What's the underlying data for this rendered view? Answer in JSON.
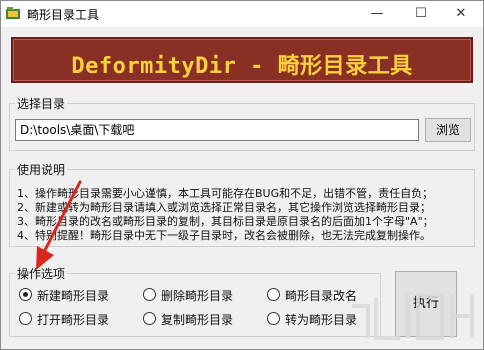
{
  "window": {
    "title": "畸形目录工具",
    "minimize_glyph": "—",
    "maximize_glyph": "☐",
    "close_glyph": "✕"
  },
  "banner": {
    "text": "DeformityDir - 畸形目录工具",
    "bg_color": "#8a2f24",
    "text_color": "#ffd13b"
  },
  "select_dir": {
    "label": "选择目录",
    "path_value": "D:\\tools\\桌面\\下载吧",
    "browse_label": "浏览"
  },
  "usage": {
    "label": "使用说明",
    "lines": [
      "1、操作畸形目录需要小心谨慎，本工具可能存在BUG和不足，出错不管，责任自负；",
      "2、新建或转为畸形目录请填入或浏览选择正常目录名，其它操作浏览选择畸形目录；",
      "3、畸形目录的改名或畸形目录的复制，其目标目录是原目录名的后面加1个字母\"A\"；",
      "4、特别提醒！畸形目录中无下一级子目录时，改名会被删除，也无法完成复制操作。"
    ]
  },
  "operations": {
    "label": "操作选项",
    "options": [
      {
        "label": "新建畸形目录",
        "checked": true
      },
      {
        "label": "删除畸形目录",
        "checked": false
      },
      {
        "label": "畸形目录改名",
        "checked": false
      },
      {
        "label": "打开畸形目录",
        "checked": false
      },
      {
        "label": "复制畸形目录",
        "checked": false
      },
      {
        "label": "转为畸形目录",
        "checked": false
      }
    ],
    "execute_label": "执行"
  },
  "annotation": {
    "arrow_color": "#d9261c"
  }
}
